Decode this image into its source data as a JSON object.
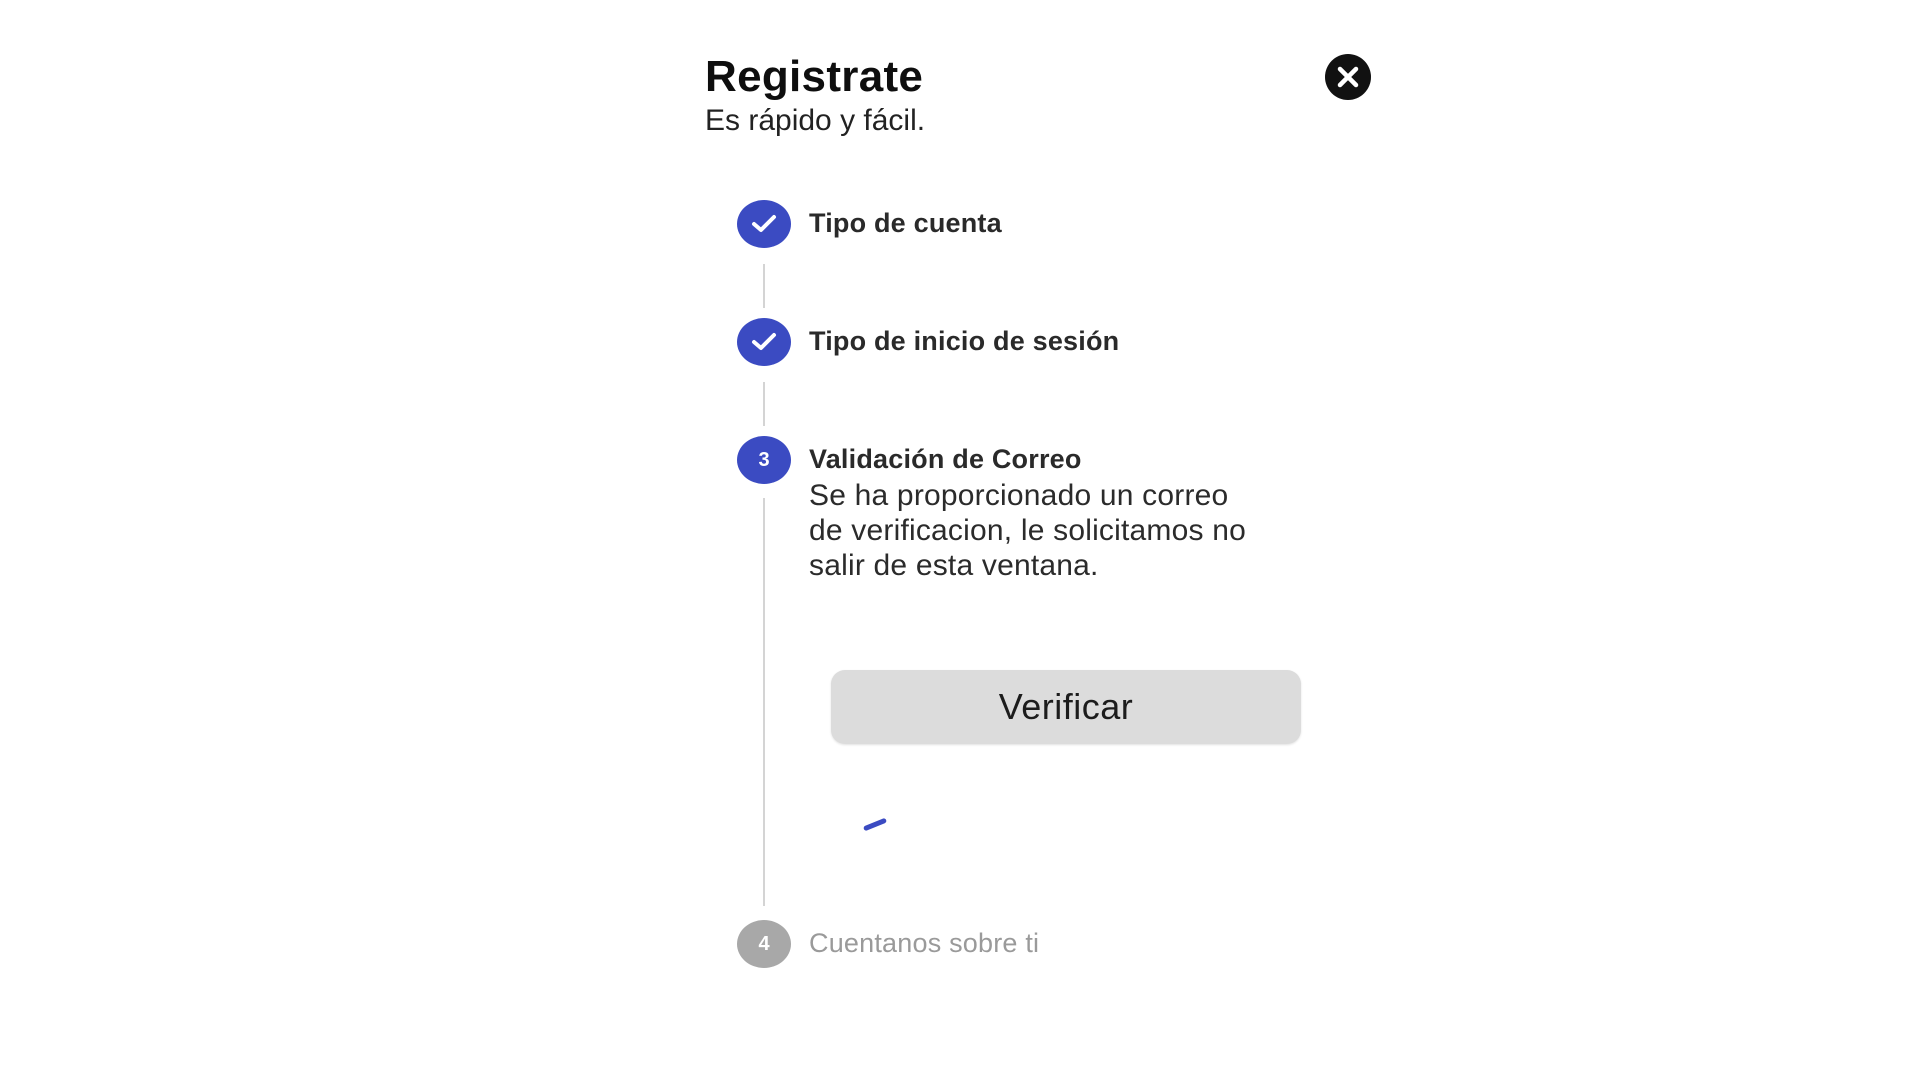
{
  "dialog": {
    "title": "Registrate",
    "subtitle": "Es rápido y fácil.",
    "close_icon": "close-circle-icon"
  },
  "steps": [
    {
      "label": "Tipo de cuenta",
      "status": "completed",
      "icon": "check-icon"
    },
    {
      "label": "Tipo de inicio de sesión",
      "status": "completed",
      "icon": "check-icon"
    },
    {
      "number": "3",
      "label": "Validación de Correo",
      "status": "active",
      "description": "Se ha proporcionado un correo de verificacion, le solicitamos no salir de esta ventana.",
      "button_label": "Verificar",
      "loading_icon": "loading-spinner-icon"
    },
    {
      "number": "4",
      "label": "Cuentanos sobre ti",
      "status": "pending"
    }
  ],
  "colors": {
    "accent": "#3b4bc2",
    "pending": "#a8a8a8",
    "button_bg": "#dcdcdc",
    "connector": "#d4d4d4"
  }
}
